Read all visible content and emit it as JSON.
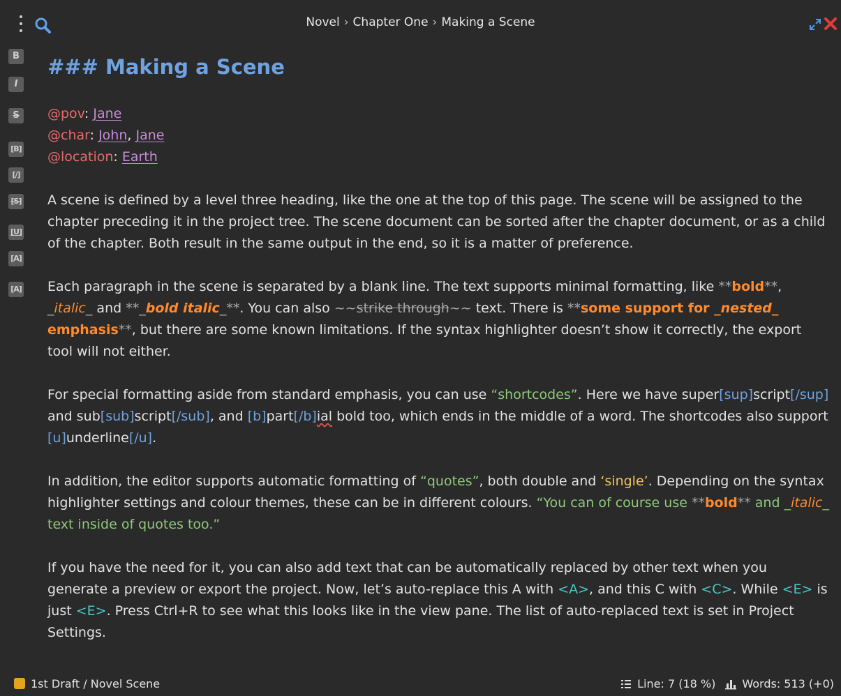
{
  "breadcrumb": {
    "a": "Novel",
    "b": "Chapter One",
    "c": "Making a Scene",
    "sep": "›"
  },
  "toolbar": {
    "bold": "B",
    "italic": "I",
    "strike": "S",
    "sc_bold": "[B]",
    "sc_italic": "[/]",
    "sc_strike": "[S]",
    "sc_underline": "[U]",
    "sc_sup": "[A]",
    "sc_sub": "[A]"
  },
  "doc": {
    "heading": "### Making a Scene",
    "pov_key": "@pov",
    "pov_val": "Jane",
    "char_key": "@char",
    "char_val1": "John",
    "char_val2": "Jane",
    "loc_key": "@location",
    "loc_val": "Earth",
    "p1": "A scene is defined by a level three heading, like the one at the top of this page. The scene will be assigned to the chapter preceding it in the project tree. The scene document can be sorted after the chapter document, or as a child of the chapter. Both result in the same output in the end, so it is a matter of preference.",
    "p2": {
      "a": "Each paragraph in the scene is separated by a blank line. The text supports minimal formatting, like ",
      "m1": "**",
      "bold": "bold",
      "m2": "**",
      "c1": ", ",
      "m3": "_",
      "italic": "italic",
      "m4": "_",
      "c2": " and ",
      "m5": "**_",
      "bolditalic": "bold italic",
      "m6": "_**",
      "c3": ". You can also ",
      "m7": "~~",
      "strike": "strike through",
      "m8": "~~",
      "c4": " text. There is ",
      "m9": "**",
      "nest1": "some support for ",
      "m10": "_",
      "nested": "nested",
      "m11": "_",
      "nest2": " emphasis",
      "m12": "**",
      "c5": ", but there are some known limitations. If the syntax highlighter doesn’t show it correctly, the export tool will not either."
    },
    "p3": {
      "a": "For special formatting aside from standard emphasis, you can use ",
      "q": "“shortcodes”",
      "b": ". Here we have super",
      "t1": "[sup]",
      "c": "script",
      "t2": "[/sup]",
      "d": " and sub",
      "t3": "[sub]",
      "e": "script",
      "t4": "[/sub]",
      "f": ", and ",
      "t5": "[b]",
      "g": "part",
      "t6": "[/b]",
      "h": "ial",
      "i": " bold too, which ends in the middle of a word. The shortcodes also support ",
      "t7": "[u]",
      "j": "underline",
      "t8": "[/u]",
      "k": "."
    },
    "p4": {
      "a": "In addition, the editor supports automatic formatting of ",
      "q1": "“quotes”",
      "b": ", both double and ",
      "q2": "‘single’",
      "c": ". Depending on the syntax highlighter settings and colour themes, these can be in different colours. ",
      "q3a": "“You can of course use ",
      "m1": "**",
      "bold": "bold",
      "m2": "**",
      "q3b": " and ",
      "m3": "_",
      "italic": "italic",
      "m4": "_",
      "q3c": " text inside of quotes too.”"
    },
    "p5": {
      "a": "If you have the need for it, you can also add text that can be automatically replaced by other text when you generate a preview or export the project. Now, let’s auto-replace this A with ",
      "r1": "<A>",
      "b": ", and this C with ",
      "r2": "<C>",
      "c": ". While ",
      "r3": "<E>",
      "d": " is just ",
      "r4": "<E>",
      "e": ". Press Ctrl+R to see what this looks like in the view pane. The list of auto-replaced text is set in Project Settings."
    }
  },
  "status": {
    "label": "1st Draft / Novel Scene",
    "line": "Line: 7 (18 %)",
    "words": "Words: 513 (+0)"
  },
  "colors": {
    "heading": "#6fa2de",
    "keyword": "#e96b6b",
    "value": "#c78bd8",
    "emphasis": "#ff8a2b",
    "shortcode": "#6fa2de",
    "double_quote": "#8ec97a",
    "single_quote": "#f2c453",
    "replace": "#48c9c4",
    "status_dot": "#e6a41d",
    "close": "#e03c3c"
  },
  "icons": [
    "menu-icon",
    "search-icon",
    "expand-icon",
    "close-icon",
    "outline-icon",
    "stats-icon"
  ]
}
